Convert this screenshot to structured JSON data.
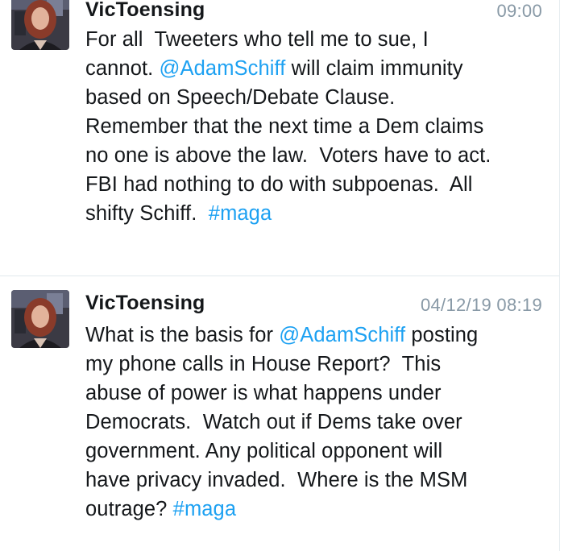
{
  "tweets": [
    {
      "author": "VicToensing",
      "timestamp": "09:00",
      "lines": [
        [
          {
            "text": "For all  Tweeters who tell me to sue, I"
          }
        ],
        [
          {
            "text": "cannot. "
          },
          {
            "text": "@AdamSchiff",
            "link": true
          },
          {
            "text": " will claim immunity"
          }
        ],
        [
          {
            "text": "based on Speech/Debate Clause."
          }
        ],
        [
          {
            "text": "Remember that the next time a Dem claims"
          }
        ],
        [
          {
            "text": "no one is above the law.  Voters have to act."
          }
        ],
        [
          {
            "text": "FBI had nothing to do with subpoenas.  All"
          }
        ],
        [
          {
            "text": "shifty Schiff.  "
          },
          {
            "text": "#maga",
            "link": true
          }
        ]
      ]
    },
    {
      "author": "VicToensing",
      "timestamp": "04/12/19 08:19",
      "lines": [
        [
          {
            "text": "What is the basis for "
          },
          {
            "text": "@AdamSchiff",
            "link": true
          },
          {
            "text": " posting"
          }
        ],
        [
          {
            "text": "my phone calls in House Report?  This"
          }
        ],
        [
          {
            "text": "abuse of power is what happens under"
          }
        ],
        [
          {
            "text": "Democrats.  Watch out if Dems take over"
          }
        ],
        [
          {
            "text": "government. Any political opponent will"
          }
        ],
        [
          {
            "text": "have privacy invaded.  Where is the MSM"
          }
        ],
        [
          {
            "text": "outrage? "
          },
          {
            "text": "#maga",
            "link": true
          }
        ]
      ]
    }
  ],
  "colors": {
    "link": "#1da1f2",
    "text": "#14171a",
    "timestamp": "#8899a6",
    "divider": "#e1e8ed"
  },
  "icons": {
    "avatar": "profile-photo"
  }
}
